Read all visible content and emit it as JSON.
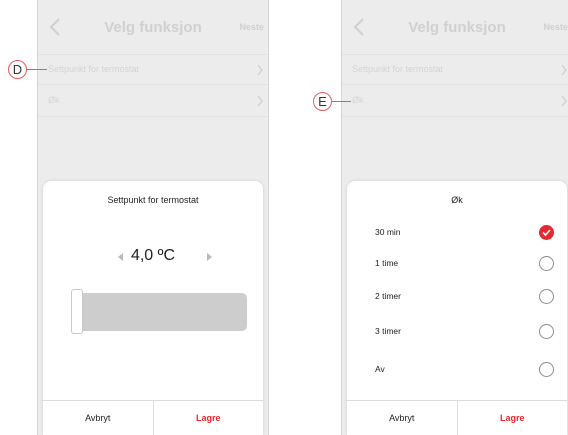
{
  "callouts": [
    "D",
    "E"
  ],
  "colors": {
    "accent": "#e52930",
    "callout": "#e45a5f",
    "dimmed": "#ececec"
  },
  "screen_d": {
    "header": {
      "title": "Velg funksjon",
      "next": "Neste",
      "back_icon": "chevron-left-icon"
    },
    "rows": [
      "Settpunkt for termostat",
      "Øk"
    ],
    "sheet": {
      "title": "Settpunkt for termostat",
      "value": "4,0 ºC",
      "slider_level": 0,
      "cancel": "Avbryt",
      "save": "Lagre"
    }
  },
  "screen_e": {
    "header": {
      "title": "Velg funksjon",
      "next": "Neste",
      "back_icon": "chevron-left-icon"
    },
    "rows": [
      "Settpunkt for termostat",
      "Øk"
    ],
    "sheet": {
      "title": "Øk",
      "options": [
        {
          "label": "30 min",
          "selected": true
        },
        {
          "label": "1 time",
          "selected": false
        },
        {
          "label": "2 timer",
          "selected": false
        },
        {
          "label": "3 timer",
          "selected": false
        },
        {
          "label": "Av",
          "selected": false
        }
      ],
      "cancel": "Avbryt",
      "save": "Lagre"
    }
  }
}
